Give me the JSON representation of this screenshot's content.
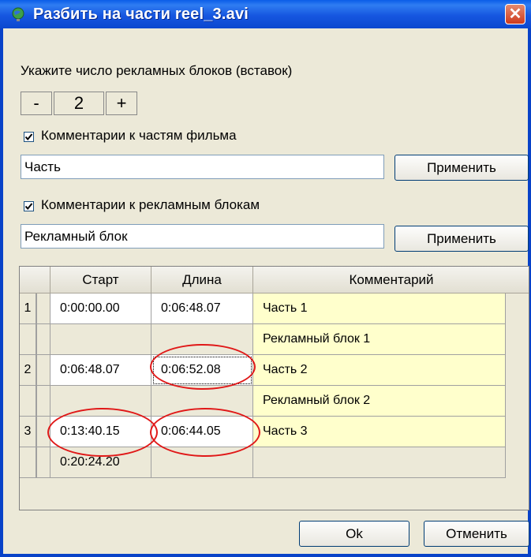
{
  "window": {
    "title": "Разбить на части reel_3.avi",
    "close_label": "✕"
  },
  "ad_blocks": {
    "label": "Укажите число рекламных блоков (вставок)",
    "minus": "-",
    "count": "2",
    "plus": "+"
  },
  "parts_comment": {
    "checkbox_label": "Комментарии к частям фильма",
    "checked": true,
    "value": "Часть",
    "apply_label": "Применить"
  },
  "ads_comment": {
    "checkbox_label": "Комментарии к рекламным блокам",
    "checked": true,
    "value": "Рекламный блок",
    "apply_label": "Применить"
  },
  "table": {
    "headers": [
      "",
      "Старт",
      "Длина",
      "Комментарий"
    ],
    "rows": [
      {
        "num": "1",
        "start": "0:00:00.00",
        "length": "0:06:48.07",
        "comment": "Часть 1"
      },
      {
        "num": "",
        "start": "",
        "length": "",
        "comment": "Рекламный блок 1"
      },
      {
        "num": "2",
        "start": "0:06:48.07",
        "length": "0:06:52.08",
        "comment": "Часть 2"
      },
      {
        "num": "",
        "start": "",
        "length": "",
        "comment": "Рекламный блок 2"
      },
      {
        "num": "3",
        "start": "0:13:40.15",
        "length": "0:06:44.05",
        "comment": "Часть 3"
      },
      {
        "num": "",
        "start": "0:20:24.20",
        "length": "",
        "comment": ""
      }
    ]
  },
  "footer": {
    "ok_label": "Ok",
    "cancel_label": "Отменить"
  },
  "colors": {
    "title_bar": "#0a5ce8",
    "highlight": "#ffffcc",
    "annotation": "#e01818"
  }
}
